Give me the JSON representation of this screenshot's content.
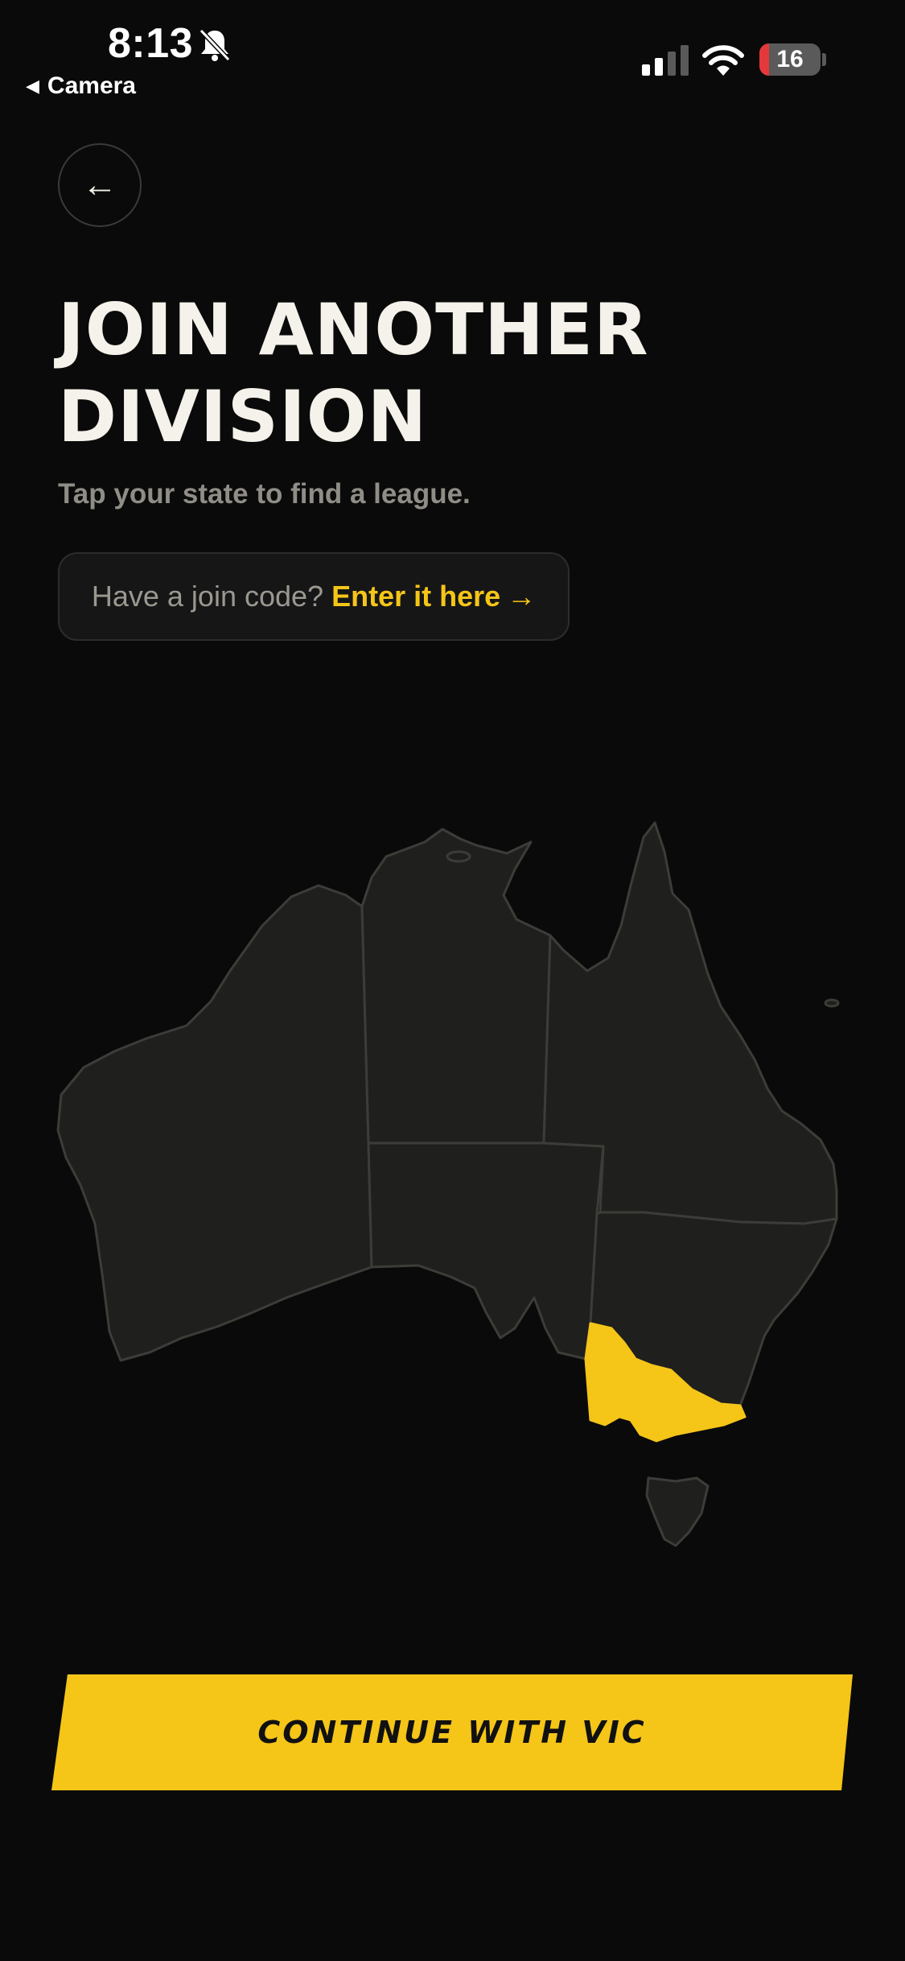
{
  "status_bar": {
    "time": "8:13",
    "back_app": "Camera",
    "battery_level": "16",
    "icons": [
      "bell-slash-icon",
      "signal-icon",
      "wifi-icon",
      "battery-icon"
    ]
  },
  "header": {
    "back_icon": "←",
    "title": "JOIN ANOTHER DIVISION",
    "subtitle": "Tap your state to find a league."
  },
  "join_code": {
    "question": "Have a join code?",
    "link_label": "Enter it here",
    "arrow": "→"
  },
  "map": {
    "states": [
      "WA",
      "NT",
      "SA",
      "QLD",
      "NSW",
      "VIC",
      "TAS"
    ],
    "selected_state": "VIC",
    "colors": {
      "state_fill": "#1f1f1d",
      "state_border": "#3c3c38",
      "selected_fill": "#f5c518"
    }
  },
  "continue_button": {
    "label": "CONTINUE WITH VIC"
  },
  "colors": {
    "background": "#0a0a0a",
    "accent": "#f5c518",
    "text": "#f4f2ea",
    "muted": "#8f8d86"
  }
}
